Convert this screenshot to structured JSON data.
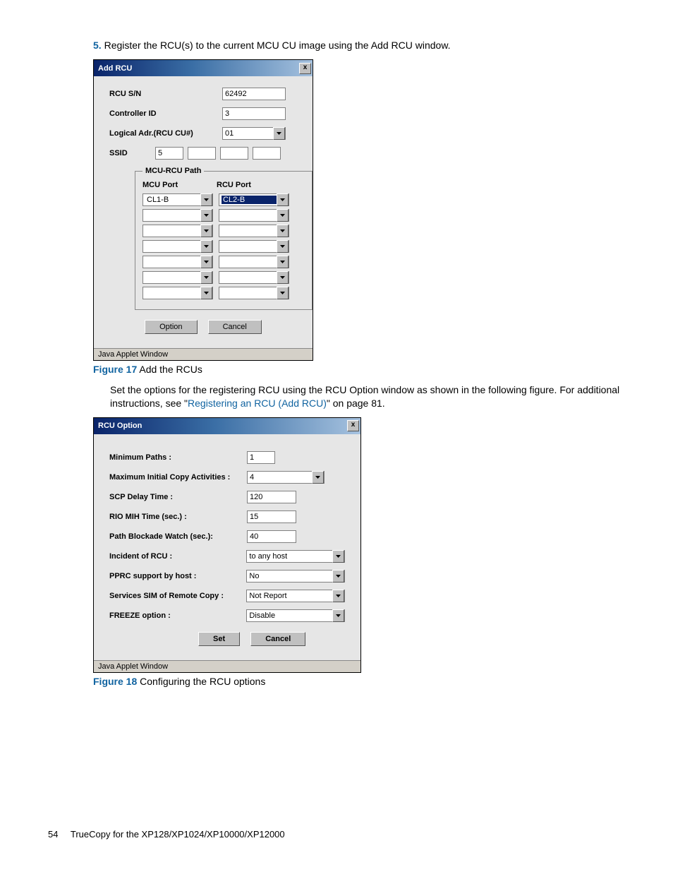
{
  "step": {
    "number": "5.",
    "text": "Register the RCU(s) to the current MCU CU image using the Add RCU window."
  },
  "addrcu": {
    "title": "Add RCU",
    "close": "x",
    "labels": {
      "sn": "RCU S/N",
      "controller": "Controller ID",
      "logical": "Logical Adr.(RCU CU#)",
      "ssid": "SSID"
    },
    "values": {
      "sn": "62492",
      "controller": "3",
      "logical": "01",
      "ssid": "5"
    },
    "path": {
      "legend": "MCU-RCU Path",
      "mcu": "MCU Port",
      "rcu": "RCU Port",
      "rows": [
        {
          "mcu": "CL1-B",
          "rcu": "CL2-B"
        },
        {
          "mcu": "",
          "rcu": ""
        },
        {
          "mcu": "",
          "rcu": ""
        },
        {
          "mcu": "",
          "rcu": ""
        },
        {
          "mcu": "",
          "rcu": ""
        },
        {
          "mcu": "",
          "rcu": ""
        },
        {
          "mcu": "",
          "rcu": ""
        }
      ]
    },
    "buttons": {
      "option": "Option",
      "cancel": "Cancel"
    },
    "status": "Java Applet Window"
  },
  "fig17": {
    "label": "Figure 17",
    "caption": " Add the RCUs"
  },
  "para": {
    "text1": "Set the options for the registering RCU using the RCU Option window as shown in the following figure. For additional instructions, see \"",
    "link": "Registering an RCU (Add RCU)",
    "text2": "\" on page 81."
  },
  "rcuopt": {
    "title": "RCU Option",
    "close": "x",
    "labels": {
      "minpaths": "Minimum Paths :",
      "maxcopy": "Maximum Initial Copy Activities :",
      "scp": "SCP Delay Time :",
      "rio": "RIO MIH Time (sec.) :",
      "pbw": "Path Blockade Watch (sec.):",
      "incident": "Incident of RCU :",
      "pprc": "PPRC support by host :",
      "sim": "Services SIM of Remote Copy :",
      "freeze": "FREEZE option :"
    },
    "values": {
      "minpaths": "1",
      "maxcopy": "4",
      "scp": "120",
      "rio": "15",
      "pbw": "40",
      "incident": "to any host",
      "pprc": "No",
      "sim": "Not Report",
      "freeze": "Disable"
    },
    "buttons": {
      "set": "Set",
      "cancel": "Cancel"
    },
    "status": "Java Applet Window"
  },
  "fig18": {
    "label": "Figure 18",
    "caption": " Configuring the RCU options"
  },
  "footer": {
    "page": "54",
    "doc": "TrueCopy for the XP128/XP1024/XP10000/XP12000"
  }
}
